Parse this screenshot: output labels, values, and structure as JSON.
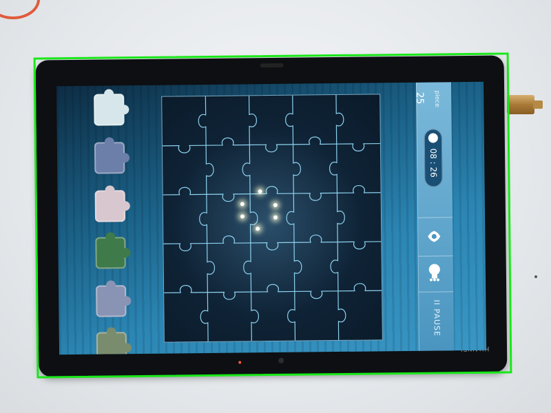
{
  "device": {
    "brand": "HUAWEI"
  },
  "game": {
    "piece_count": "25",
    "piece_label": "piece",
    "timer": "08 : 26",
    "pause_label": "II PAUSE",
    "grid": {
      "rows": 5,
      "cols": 5
    }
  },
  "tray": {
    "pieces": [
      {
        "name": "tray-piece-1",
        "color": "#d6e6ea"
      },
      {
        "name": "tray-piece-2",
        "color": "#6b7fa8"
      },
      {
        "name": "tray-piece-3",
        "color": "#d8c7cf"
      },
      {
        "name": "tray-piece-4",
        "color": "#3f7a4a"
      },
      {
        "name": "tray-piece-5",
        "color": "#8994b4"
      },
      {
        "name": "tray-piece-6",
        "color": "#7a8c6e"
      }
    ]
  },
  "colors": {
    "highlight": "#18e818",
    "screen_accent": "#2b86b4",
    "grid_line": "#8fd3f0"
  },
  "icons": {
    "eye": "eye-icon",
    "hint": "lightbulb-icon",
    "timer": "clock-icon"
  }
}
